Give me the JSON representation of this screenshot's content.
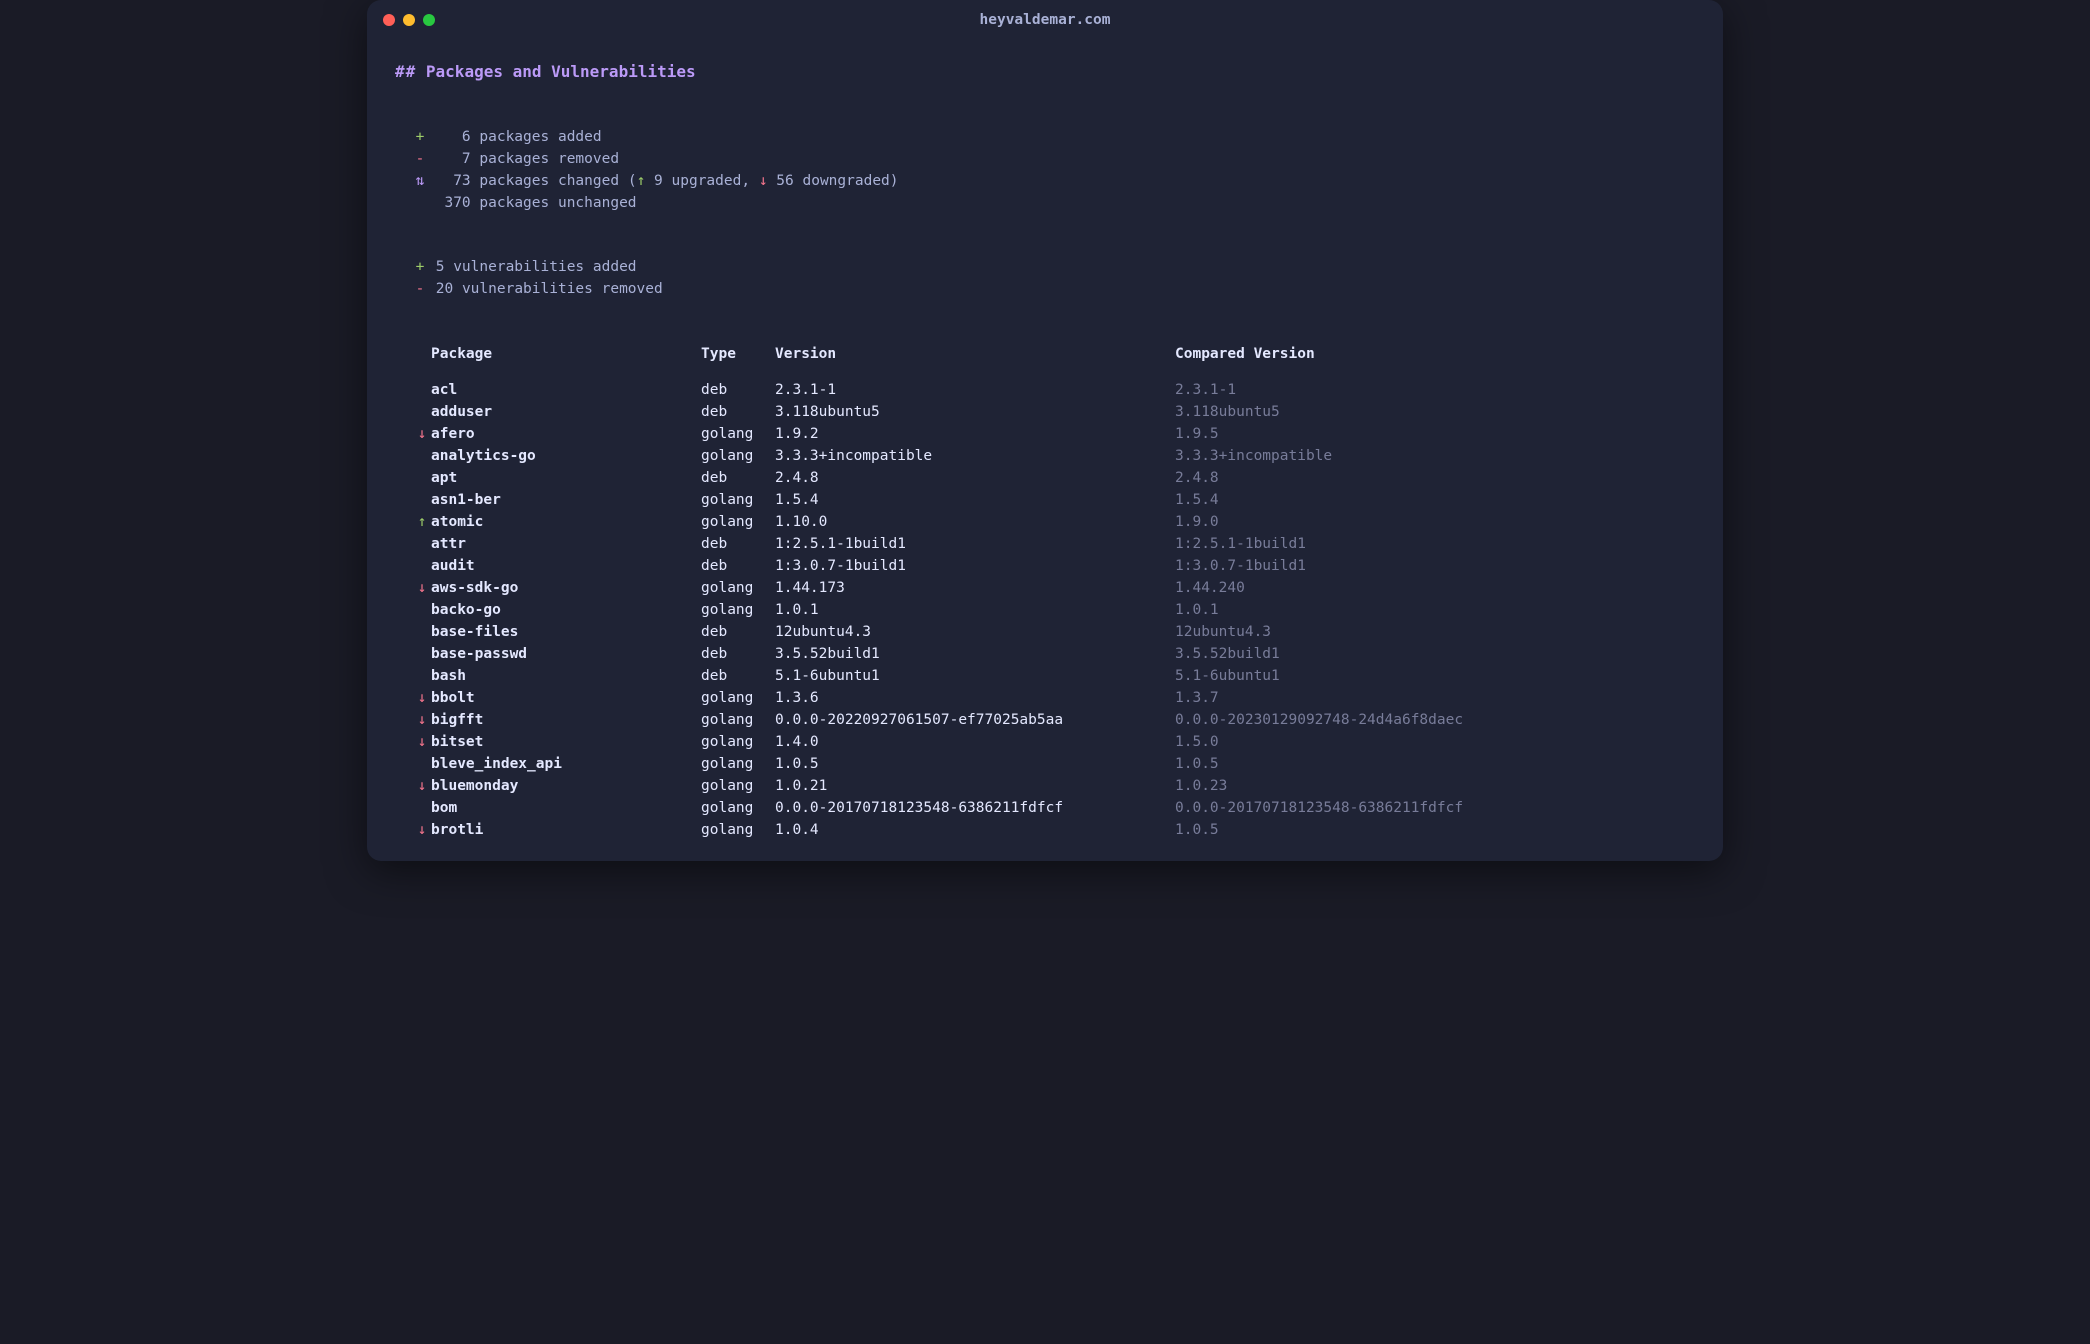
{
  "window": {
    "title": "heyvaldemar.com"
  },
  "heading": {
    "hash": "##",
    "text": "Packages and Vulnerabilities"
  },
  "summary": {
    "added": {
      "sym": "+",
      "count": "6",
      "label": "packages added"
    },
    "removed": {
      "sym": "-",
      "count": "7",
      "label": "packages removed"
    },
    "changed": {
      "sym": "⇅",
      "count": "73",
      "label": "packages changed",
      "detail_open": " (",
      "up_arrow": "↑",
      "up_count": "9",
      "upgraded": "upgraded",
      "sep": ", ",
      "down_arrow": "↓",
      "down_count": "56",
      "downgraded": "downgraded",
      "detail_close": ")"
    },
    "unchanged": {
      "sym": "",
      "count": "370",
      "label": "packages unchanged"
    }
  },
  "vuln": {
    "added": {
      "sym": "+",
      "count": "5",
      "label": "vulnerabilities added"
    },
    "removed": {
      "sym": "-",
      "count": "20",
      "label": "vulnerabilities removed"
    }
  },
  "headers": {
    "package": "Package",
    "type": "Type",
    "version": "Version",
    "compared": "Compared Version"
  },
  "rows": [
    {
      "arrow": "",
      "pkg": "acl",
      "type": "deb",
      "ver": "2.3.1-1",
      "cpver": "2.3.1-1"
    },
    {
      "arrow": "",
      "pkg": "adduser",
      "type": "deb",
      "ver": "3.118ubuntu5",
      "cpver": "3.118ubuntu5"
    },
    {
      "arrow": "down",
      "pkg": "afero",
      "type": "golang",
      "ver": "1.9.2",
      "cpver": "1.9.5"
    },
    {
      "arrow": "",
      "pkg": "analytics-go",
      "type": "golang",
      "ver": "3.3.3+incompatible",
      "cpver": "3.3.3+incompatible"
    },
    {
      "arrow": "",
      "pkg": "apt",
      "type": "deb",
      "ver": "2.4.8",
      "cpver": "2.4.8"
    },
    {
      "arrow": "",
      "pkg": "asn1-ber",
      "type": "golang",
      "ver": "1.5.4",
      "cpver": "1.5.4"
    },
    {
      "arrow": "up",
      "pkg": "atomic",
      "type": "golang",
      "ver": "1.10.0",
      "cpver": "1.9.0"
    },
    {
      "arrow": "",
      "pkg": "attr",
      "type": "deb",
      "ver": "1:2.5.1-1build1",
      "cpver": "1:2.5.1-1build1"
    },
    {
      "arrow": "",
      "pkg": "audit",
      "type": "deb",
      "ver": "1:3.0.7-1build1",
      "cpver": "1:3.0.7-1build1"
    },
    {
      "arrow": "down",
      "pkg": "aws-sdk-go",
      "type": "golang",
      "ver": "1.44.173",
      "cpver": "1.44.240"
    },
    {
      "arrow": "",
      "pkg": "backo-go",
      "type": "golang",
      "ver": "1.0.1",
      "cpver": "1.0.1"
    },
    {
      "arrow": "",
      "pkg": "base-files",
      "type": "deb",
      "ver": "12ubuntu4.3",
      "cpver": "12ubuntu4.3"
    },
    {
      "arrow": "",
      "pkg": "base-passwd",
      "type": "deb",
      "ver": "3.5.52build1",
      "cpver": "3.5.52build1"
    },
    {
      "arrow": "",
      "pkg": "bash",
      "type": "deb",
      "ver": "5.1-6ubuntu1",
      "cpver": "5.1-6ubuntu1"
    },
    {
      "arrow": "down",
      "pkg": "bbolt",
      "type": "golang",
      "ver": "1.3.6",
      "cpver": "1.3.7"
    },
    {
      "arrow": "down",
      "pkg": "bigfft",
      "type": "golang",
      "ver": "0.0.0-20220927061507-ef77025ab5aa",
      "cpver": "0.0.0-20230129092748-24d4a6f8daec"
    },
    {
      "arrow": "down",
      "pkg": "bitset",
      "type": "golang",
      "ver": "1.4.0",
      "cpver": "1.5.0"
    },
    {
      "arrow": "",
      "pkg": "bleve_index_api",
      "type": "golang",
      "ver": "1.0.5",
      "cpver": "1.0.5"
    },
    {
      "arrow": "down",
      "pkg": "bluemonday",
      "type": "golang",
      "ver": "1.0.21",
      "cpver": "1.0.23"
    },
    {
      "arrow": "",
      "pkg": "bom",
      "type": "golang",
      "ver": "0.0.0-20170718123548-6386211fdfcf",
      "cpver": "0.0.0-20170718123548-6386211fdfcf"
    },
    {
      "arrow": "down",
      "pkg": "brotli",
      "type": "golang",
      "ver": "1.0.4",
      "cpver": "1.0.5"
    }
  ]
}
